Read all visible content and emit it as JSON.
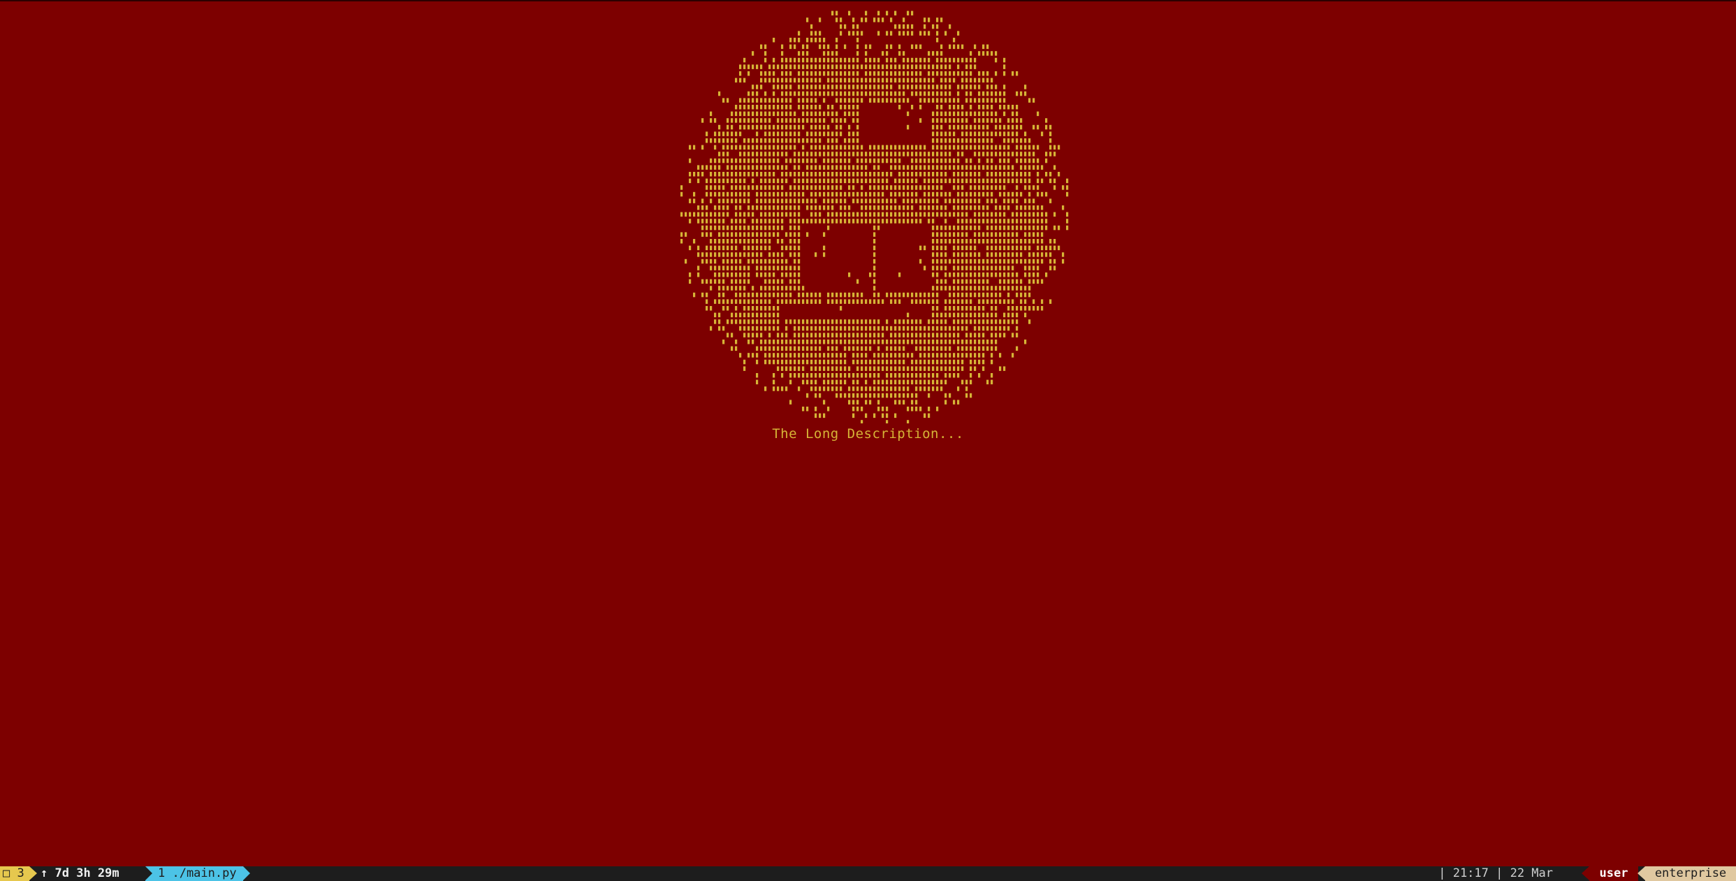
{
  "terminal": {
    "caption": "The Long Description..."
  },
  "statusbar": {
    "session_icon": "window-icon",
    "session_number": "3",
    "uptime_icon": "up-arrow-icon",
    "uptime": "7d 3h 29m",
    "window_label": "1 ./main.py",
    "time": "| 21:17 | 22 Mar",
    "user": "user",
    "host": "enterprise"
  },
  "colors": {
    "background": "#7d0000",
    "art": "#d6b437",
    "session_segment": "#e6c84e",
    "window_segment": "#4cc3e6",
    "host_segment": "#e0c8a0"
  }
}
